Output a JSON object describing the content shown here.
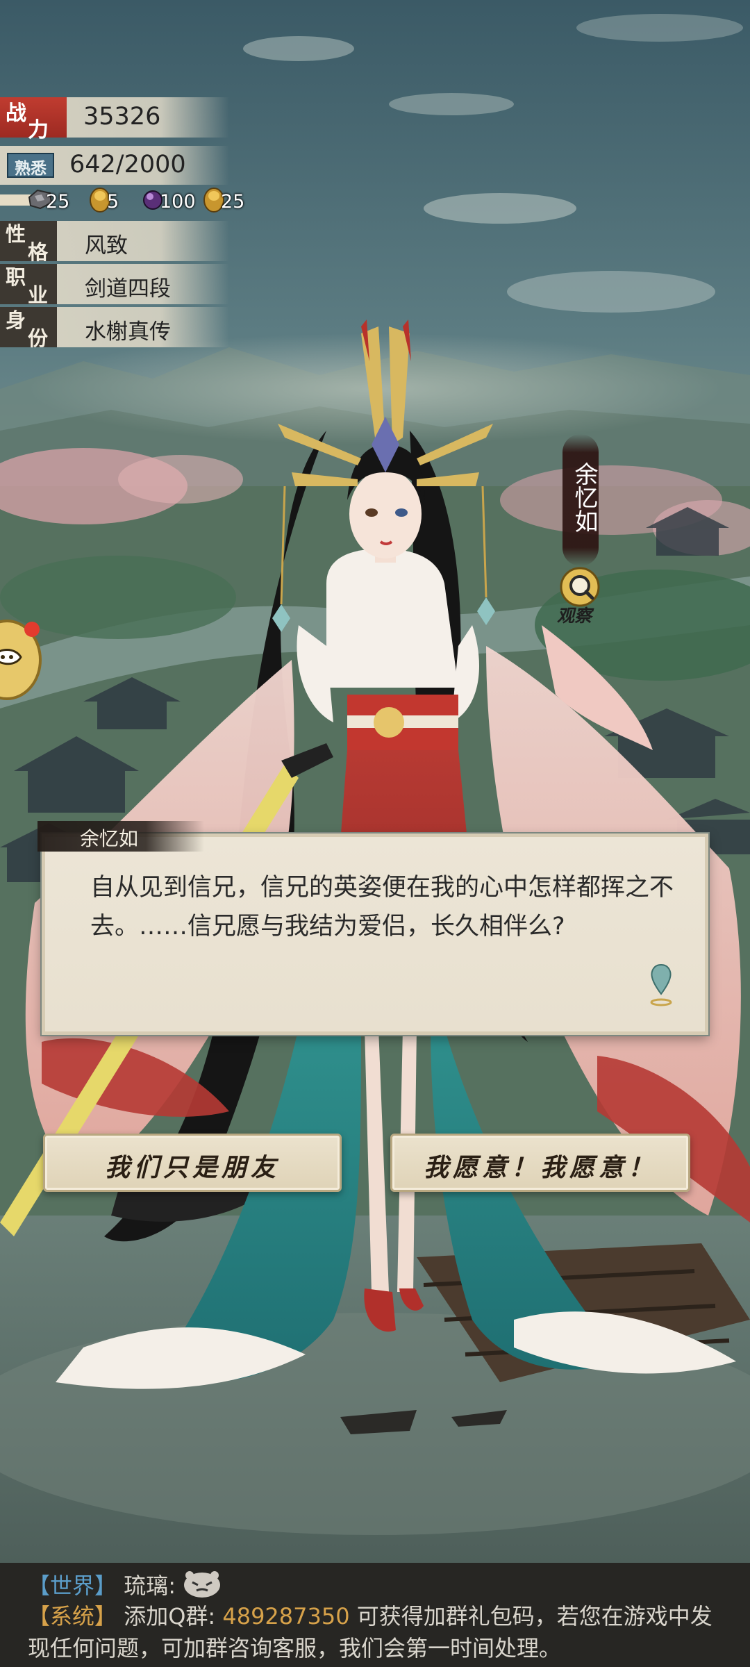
{
  "stats": {
    "power_label_1": "战",
    "power_label_2": "力",
    "power_value": "35326",
    "familiarity_label": "熟悉",
    "familiarity_value": "642/2000",
    "resources": [
      {
        "icon": "ore-icon",
        "count": "25"
      },
      {
        "icon": "gold-ingot-icon",
        "count": "5"
      },
      {
        "icon": "purple-gem-icon",
        "count": "100"
      },
      {
        "icon": "gold-ingot-icon",
        "count": "25"
      }
    ],
    "rows": [
      {
        "label_1": "性",
        "label_2": "格",
        "value": "风致"
      },
      {
        "label_1": "职",
        "label_2": "业",
        "value": "剑道四段"
      },
      {
        "label_1": "身",
        "label_2": "份",
        "value": "水榭真传"
      }
    ]
  },
  "character": {
    "name": "余忆如",
    "observe_label": "观察"
  },
  "dialogue": {
    "speaker": "余忆如",
    "text": "自从见到信兄，信兄的英姿便在我的心中怎样都挥之不去。……信兄愿与我结为爱侣，长久相伴么?"
  },
  "choices": {
    "friends": "我们只是朋友",
    "accept": "我愿意！我愿意！"
  },
  "chat": {
    "world_tag": "【世界】",
    "world_user": "琉璃:",
    "system_tag": "【系统】",
    "system_text_1": "添加Q群:",
    "system_number": "489287350",
    "system_text_2": "可获得加群礼包码，若您在游戏中发",
    "system_text_3": "现任何问题，可加群咨询客服，我们会第一时间处理。"
  },
  "colors": {
    "power_tag": "#b5352b",
    "chat_world": "#5b9dc9",
    "chat_system": "#d7a24a"
  }
}
